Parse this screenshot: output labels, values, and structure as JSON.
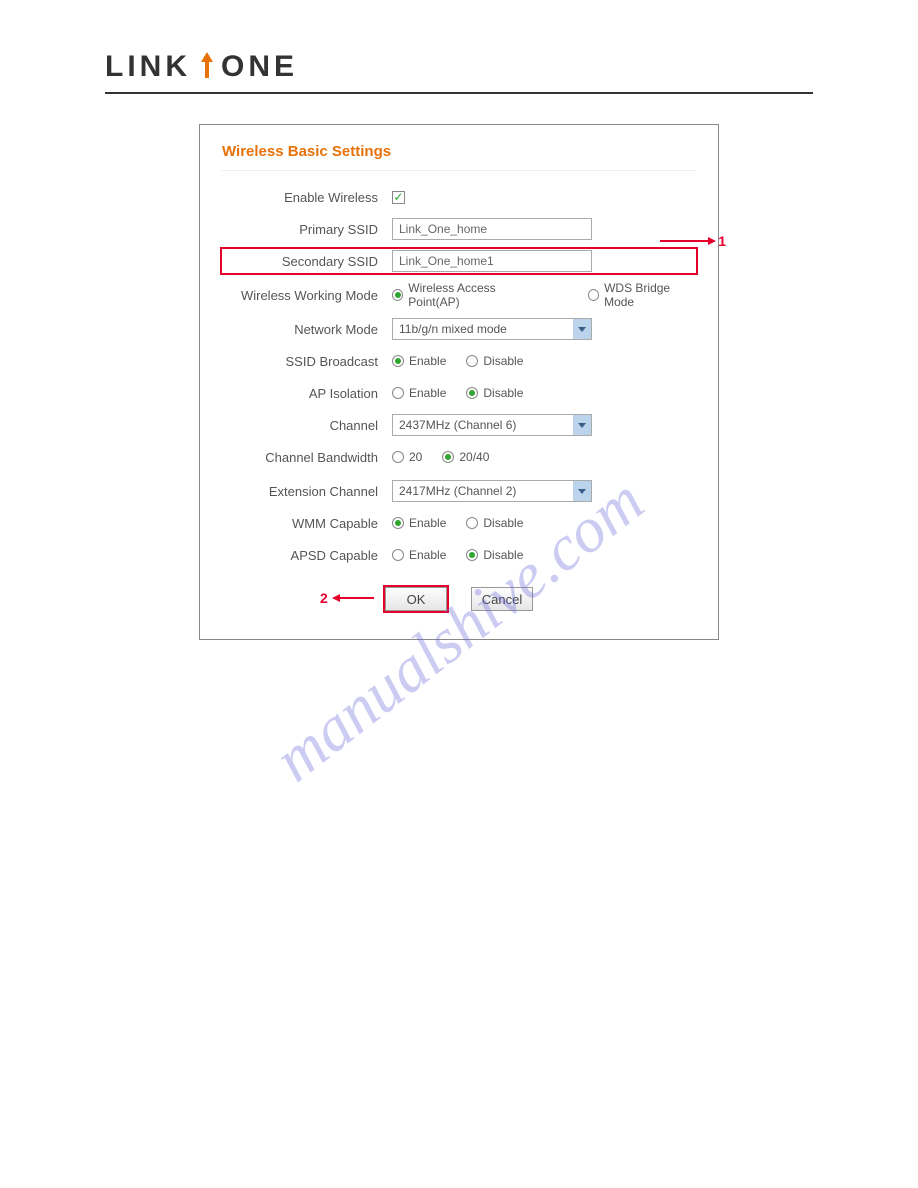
{
  "brand": {
    "part1": "LINK",
    "part2": "ONE"
  },
  "panel": {
    "title": "Wireless Basic Settings",
    "fields": {
      "enable_wireless": {
        "label": "Enable Wireless",
        "checked": true
      },
      "primary_ssid": {
        "label": "Primary SSID",
        "value": "Link_One_home"
      },
      "secondary_ssid": {
        "label": "Secondary SSID",
        "value": "Link_One_home1"
      },
      "working_mode": {
        "label": "Wireless Working Mode",
        "opt1": "Wireless Access Point(AP)",
        "opt2": "WDS Bridge Mode",
        "selected": "opt1"
      },
      "network_mode": {
        "label": "Network Mode",
        "value": "11b/g/n mixed mode"
      },
      "ssid_broadcast": {
        "label": "SSID Broadcast",
        "opt1": "Enable",
        "opt2": "Disable",
        "selected": "opt1"
      },
      "ap_isolation": {
        "label": "AP Isolation",
        "opt1": "Enable",
        "opt2": "Disable",
        "selected": "opt2"
      },
      "channel": {
        "label": "Channel",
        "value": "2437MHz (Channel 6)"
      },
      "bandwidth": {
        "label": "Channel Bandwidth",
        "opt1": "20",
        "opt2": "20/40",
        "selected": "opt2"
      },
      "ext_channel": {
        "label": "Extension Channel",
        "value": "2417MHz (Channel 2)"
      },
      "wmm": {
        "label": "WMM Capable",
        "opt1": "Enable",
        "opt2": "Disable",
        "selected": "opt1"
      },
      "apsd": {
        "label": "APSD Capable",
        "opt1": "Enable",
        "opt2": "Disable",
        "selected": "opt2"
      }
    },
    "buttons": {
      "ok": "OK",
      "cancel": "Cancel"
    }
  },
  "callouts": {
    "one": "1",
    "two": "2"
  },
  "watermark": "manualshive.com"
}
